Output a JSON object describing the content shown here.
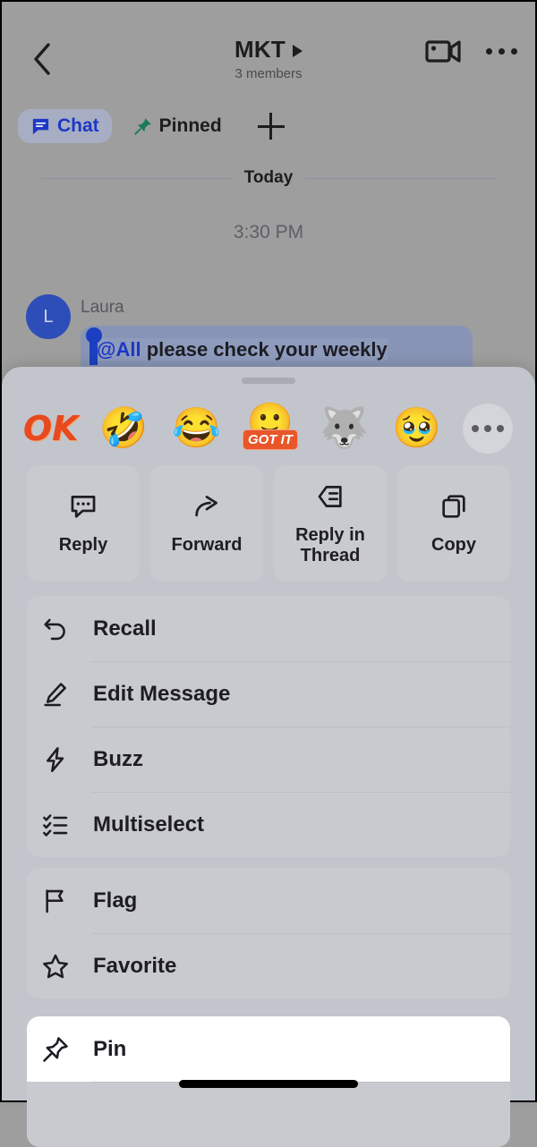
{
  "header": {
    "back_icon": "chevron-left-icon",
    "title": "MKT",
    "title_caret_icon": "caret-right-icon",
    "members": "3 members",
    "video_icon": "video-camera-icon",
    "more_icon": "more-horizontal-icon"
  },
  "tabs": [
    {
      "label": "Chat",
      "icon": "chat-bubble-icon",
      "active": true
    },
    {
      "label": "Pinned",
      "icon": "pin-icon",
      "active": false
    }
  ],
  "tab_add_label": "+",
  "conversation": {
    "day_divider": "Today",
    "timestamp": "3:30 PM",
    "message": {
      "avatar_initial": "L",
      "sender": "Laura",
      "mention": "@All",
      "text": " please check your weekly"
    }
  },
  "sheet": {
    "grabber": "drag-handle",
    "reactions": [
      {
        "name": "ok-emoji",
        "glyph": "OK",
        "kind": "text"
      },
      {
        "name": "laughing-crying-emoji",
        "glyph": "🤣",
        "kind": "emoji"
      },
      {
        "name": "tears-of-joy-emoji",
        "glyph": "😂",
        "kind": "emoji"
      },
      {
        "name": "got-it-emoji",
        "glyph": "GOT IT",
        "kind": "badge",
        "face": "🙂"
      },
      {
        "name": "wolf-emoji",
        "glyph": "🐺",
        "kind": "emoji"
      },
      {
        "name": "pleading-face-emoji",
        "glyph": "🥹",
        "kind": "emoji"
      },
      {
        "name": "more-reactions",
        "glyph": "",
        "kind": "more"
      }
    ],
    "quick_actions": [
      {
        "label": "Reply",
        "icon": "reply-bubble-icon"
      },
      {
        "label": "Forward",
        "icon": "forward-arrow-icon"
      },
      {
        "label": "Reply in Thread",
        "icon": "reply-in-thread-icon"
      },
      {
        "label": "Copy",
        "icon": "copy-icon"
      }
    ],
    "menu_group_1": [
      {
        "label": "Recall",
        "icon": "undo-arrow-icon"
      },
      {
        "label": "Edit Message",
        "icon": "pencil-icon"
      },
      {
        "label": "Buzz",
        "icon": "lightning-bolt-icon"
      },
      {
        "label": "Multiselect",
        "icon": "checklist-icon"
      }
    ],
    "menu_group_2": [
      {
        "label": "Flag",
        "icon": "flag-icon"
      },
      {
        "label": "Favorite",
        "icon": "star-icon"
      }
    ],
    "menu_group_3": [
      {
        "label": "Pin",
        "icon": "pin-icon",
        "selected": true
      }
    ]
  },
  "colors": {
    "accent_blue": "#1d38c4",
    "tab_active_bg": "#a7aec4",
    "sheet_bg": "#c3c5cc",
    "card_bg": "#c8cacf",
    "selected_bg": "#ffffff",
    "avatar_bg": "#2d4eb8",
    "pin_green": "#1a7a5e",
    "ok_orange": "#e8491f"
  },
  "home_indicator": "home-bar"
}
